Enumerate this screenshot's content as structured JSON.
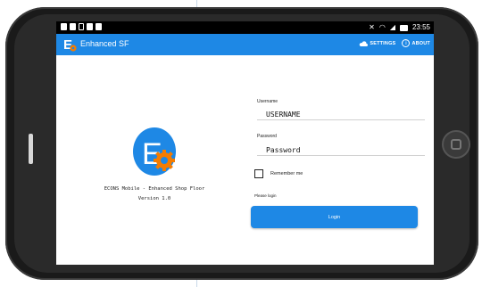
{
  "status_bar": {
    "time": "23:55",
    "left_icons": [
      "notification-icon",
      "notification-icon",
      "notification-icon",
      "notification-icon",
      "notification-icon"
    ],
    "right_icons": [
      "mute-icon",
      "wifi-icon",
      "signal-icon",
      "battery-icon"
    ]
  },
  "app_bar": {
    "title": "Enhanced SF",
    "settings_label": "SETTINGS",
    "about_label": "ABOUT",
    "background": "#1e88e5"
  },
  "splash": {
    "caption_line1": "ECONS Mobile - Enhanced Shop Floor",
    "caption_line2": "Version 1.0",
    "logo_letter": "E",
    "logo_color": "#1e88e5",
    "gear_color": "#f57c00"
  },
  "form": {
    "username_label": "Username",
    "username_value": "USERNAME",
    "password_label": "Password",
    "password_value": "Password",
    "remember_label": "Remember me",
    "remember_checked": false,
    "message": "Please login",
    "login_label": "Login"
  }
}
